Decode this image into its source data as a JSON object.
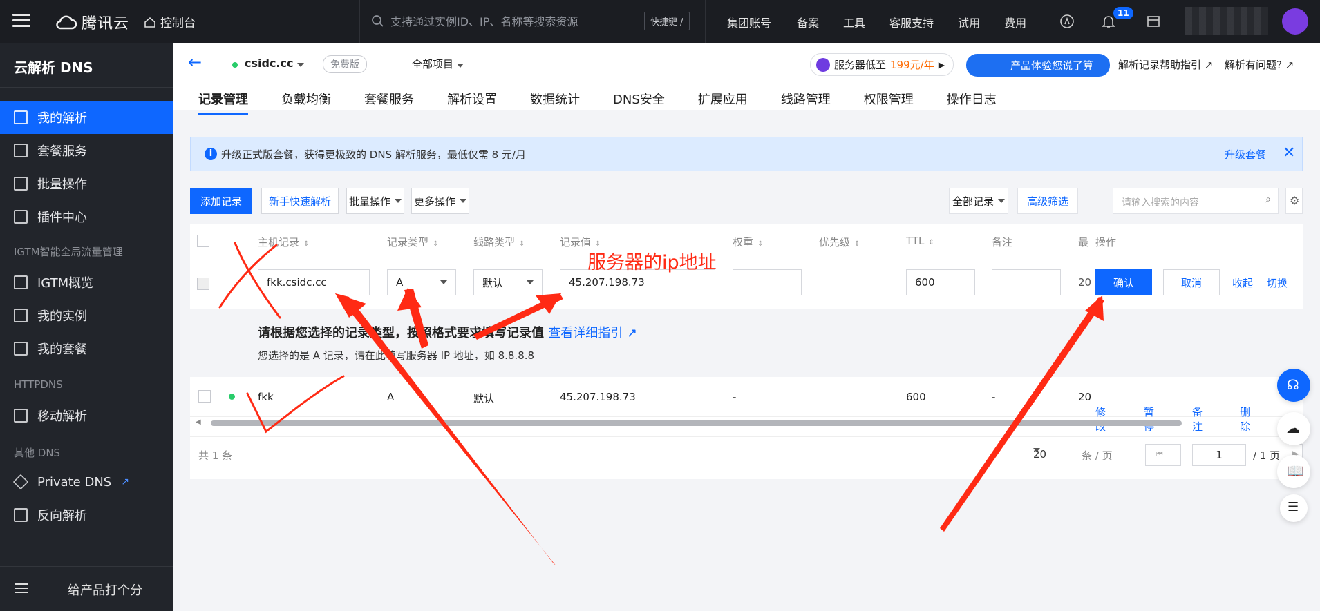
{
  "topbar": {
    "brand": "腾讯云",
    "console": "控制台",
    "search_placeholder": "支持通过实例ID、IP、名称等搜索资源",
    "shortcut": "快捷键 /",
    "nav": [
      "集团账号",
      "备案",
      "工具",
      "客服支持",
      "试用",
      "费用"
    ],
    "notifications": "11"
  },
  "sidebar": {
    "title": "云解析 DNS",
    "items": [
      {
        "label": "我的解析",
        "icon": "dns-record-icon"
      },
      {
        "label": "套餐服务",
        "icon": "package-icon"
      },
      {
        "label": "批量操作",
        "icon": "batch-icon"
      },
      {
        "label": "插件中心",
        "icon": "plugin-icon"
      }
    ],
    "group_igtm": "IGTM智能全局流量管理",
    "igtm_items": [
      {
        "label": "IGTM概览",
        "icon": "grid-icon"
      },
      {
        "label": "我的实例",
        "icon": "instance-icon"
      },
      {
        "label": "我的套餐",
        "icon": "list-icon"
      }
    ],
    "group_httpdns": "HTTPDNS",
    "httpdns_items": [
      {
        "label": "移动解析",
        "icon": "mobile-dns-icon"
      }
    ],
    "group_other": "其他 DNS",
    "other_items": [
      {
        "label": "Private DNS",
        "icon": "diamond-icon"
      },
      {
        "label": "反向解析",
        "icon": "reverse-icon"
      }
    ],
    "feedback": "给产品打个分"
  },
  "header": {
    "domain": "csidc.cc",
    "plan": "免费版",
    "project": "全部项目",
    "promo_text": "服务器低至",
    "promo_price": "199元/年",
    "experience": "产品体验您说了算",
    "help_guide": "解析记录帮助指引",
    "help_question": "解析有问题?"
  },
  "tabs": [
    "记录管理",
    "负载均衡",
    "套餐服务",
    "解析设置",
    "数据统计",
    "DNS安全",
    "扩展应用",
    "线路管理",
    "权限管理",
    "操作日志"
  ],
  "notice": {
    "text": "升级正式版套餐，获得更极致的 DNS 解析服务，最低仅需 8 元/月",
    "link": "升级套餐"
  },
  "toolbar": {
    "add": "添加记录",
    "quick": "新手快速解析",
    "batch": "批量操作",
    "more": "更多操作",
    "filter": "全部记录",
    "advanced": "高级筛选",
    "search_placeholder": "请输入搜索的内容"
  },
  "table": {
    "columns": [
      "主机记录",
      "记录类型",
      "线路类型",
      "记录值",
      "权重",
      "优先级",
      "TTL",
      "备注",
      "最",
      "操作"
    ],
    "edit_row": {
      "host": "fkk.csidc.cc",
      "type": "A",
      "line": "默认",
      "value": "45.207.198.73",
      "ttl": "600",
      "truncated": "20",
      "confirm": "确认",
      "cancel": "取消",
      "collapse": "收起",
      "switch": "切换"
    },
    "hint_title": "请根据您选择的记录类型，按照格式要求填写记录值",
    "hint_link": "查看详细指引",
    "hint_body": "您选择的是 A 记录，请在此填写服务器 IP 地址，如 8.8.8.8",
    "rows": [
      {
        "host": "fkk",
        "type": "A",
        "line": "默认",
        "value": "45.207.198.73",
        "weight": "-",
        "ttl": "600",
        "remark": "-",
        "truncated": "20",
        "ops": [
          "修改",
          "暂停",
          "备注",
          "删除"
        ]
      }
    ]
  },
  "pager": {
    "total": "共 1 条",
    "page_size": "20",
    "per_page": "条 / 页",
    "page": "1",
    "pages": "/ 1 页"
  },
  "annotation": "服务器的ip地址",
  "colors": {
    "primary": "#0e67ff",
    "sidebar": "#22252b",
    "topbar": "#1b1d22",
    "annotation": "#ff2a14"
  }
}
